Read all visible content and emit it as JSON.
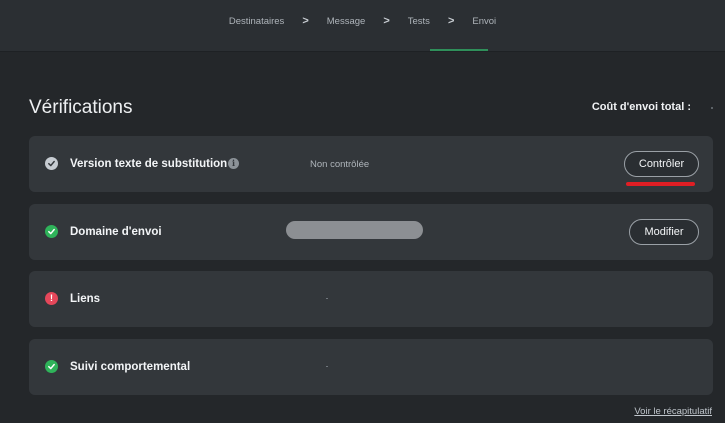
{
  "steps": [
    "Destinataires",
    "Message",
    "Tests",
    "Envoi"
  ],
  "step_separator": ">",
  "active_step": "Tests",
  "heading": "Vérifications",
  "cost_label": "Coût d'envoi total :",
  "checks": [
    {
      "title": "Version texte de substitution",
      "status": "neutral",
      "info_icon": "i",
      "value": "Non contrôlée",
      "button": "Contrôler"
    },
    {
      "title": "Domaine d'envoi",
      "status": "ok",
      "button": "Modifier"
    },
    {
      "title": "Liens",
      "status": "error",
      "error_mark": "!"
    },
    {
      "title": "Suivi comportemental",
      "status": "ok"
    }
  ],
  "summary_link": "Voir le récapitulatif",
  "colors": {
    "background": "#24272a",
    "card": "#33373b",
    "ok": "#2fb35a",
    "error": "#e5475a",
    "neutral": "#c7ccd2",
    "annotation": "#e01e24",
    "active_step_underline": "#2f8f5a"
  }
}
